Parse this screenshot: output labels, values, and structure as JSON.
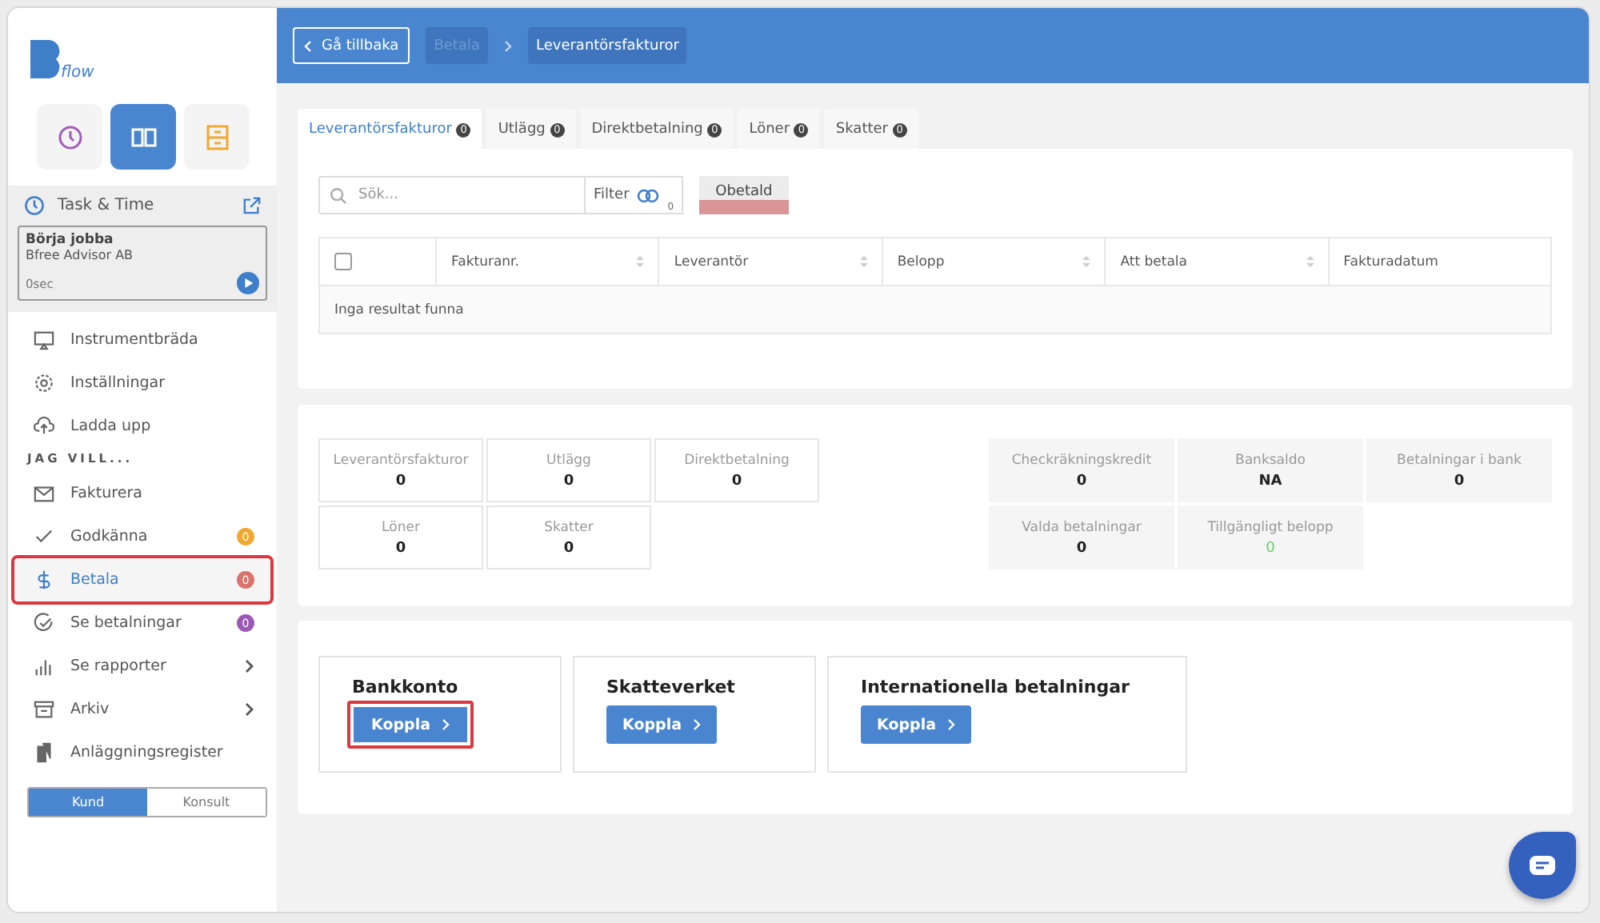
{
  "logo": {
    "text": "flow"
  },
  "app_tiles": [
    {
      "kind": "clock",
      "selected": false
    },
    {
      "kind": "book",
      "selected": true
    },
    {
      "kind": "cabinet",
      "selected": false
    }
  ],
  "task_time": {
    "title": "Task & Time",
    "card_title": "Börja jobba",
    "company": "Bfree Advisor AB",
    "elapsed": "0sec"
  },
  "nav": [
    {
      "label": "Instrumentbräda",
      "kind": "monitor",
      "selected": false
    },
    {
      "label": "Inställningar",
      "kind": "gear",
      "selected": false
    },
    {
      "label": "Ladda upp",
      "kind": "upload",
      "selected": false
    }
  ],
  "nav_section": "JAG VILL...",
  "nav2": [
    {
      "label": "Fakturera",
      "kind": "mail",
      "selected": false
    },
    {
      "label": "Godkänna",
      "kind": "check",
      "selected": false,
      "badge": "0",
      "color": "#f0a830"
    },
    {
      "label": "Betala",
      "kind": "dollar",
      "selected": true,
      "highlighted": true,
      "badge": "0",
      "color": "#d9736b"
    },
    {
      "label": "Se betalningar",
      "kind": "checkcircle",
      "selected": false,
      "badge": "0",
      "color": "#9b59b6"
    },
    {
      "label": "Se rapporter",
      "kind": "bars",
      "selected": false,
      "submenu": true
    },
    {
      "label": "Arkiv",
      "kind": "archive",
      "selected": false,
      "submenu": true
    },
    {
      "label": "Anläggningsregister",
      "kind": "files",
      "selected": false
    }
  ],
  "mode_toggle": [
    {
      "label": "Kund",
      "selected": true
    },
    {
      "label": "Konsult",
      "selected": false
    }
  ],
  "header": {
    "back": "Gå tillbaka",
    "breadcrumbs": [
      {
        "label": "Betala",
        "selected": false
      },
      {
        "label": "Leverantörsfakturor",
        "selected": true
      }
    ]
  },
  "tabs": [
    {
      "label": "Leverantörsfakturor",
      "count": "0",
      "selected": true
    },
    {
      "label": "Utlägg",
      "count": "0",
      "selected": false
    },
    {
      "label": "Direktbetalning",
      "count": "0",
      "selected": false
    },
    {
      "label": "Löner",
      "count": "0",
      "selected": false
    },
    {
      "label": "Skatter",
      "count": "0",
      "selected": false
    }
  ],
  "search": {
    "placeholder": "Sök...",
    "filter": "Filter",
    "filter_count": "0",
    "status_chip": "Obetald"
  },
  "table": {
    "select_all_checked": false,
    "columns": [
      {
        "label": "Fakturanr.",
        "sortable": true
      },
      {
        "label": "Leverantör",
        "sortable": true
      },
      {
        "label": "Belopp",
        "sortable": true
      },
      {
        "label": "Att betala",
        "sortable": true
      },
      {
        "label": "Fakturadatum",
        "sortable": false
      }
    ],
    "empty": "Inga resultat funna"
  },
  "counts": [
    {
      "label": "Leverantörsfakturor",
      "value": "0"
    },
    {
      "label": "Utlägg",
      "value": "0"
    },
    {
      "label": "Direktbetalning",
      "value": "0"
    },
    {
      "label": "Löner",
      "value": "0"
    },
    {
      "label": "Skatter",
      "value": "0"
    }
  ],
  "balances": [
    {
      "label": "Checkräkningskredit",
      "value": "0",
      "positive": false
    },
    {
      "label": "Banksaldo",
      "value": "NA",
      "positive": false
    },
    {
      "label": "Betalningar i bank",
      "value": "0",
      "positive": false
    },
    {
      "label": "Valda betalningar",
      "value": "0",
      "positive": false
    },
    {
      "label": "Tillgängligt belopp",
      "value": "0",
      "positive": true
    }
  ],
  "connections": [
    {
      "title": "Bankkonto",
      "button": "Koppla",
      "highlighted": true
    },
    {
      "title": "Skatteverket",
      "button": "Koppla",
      "highlighted": false
    },
    {
      "title": "Internationella betalningar",
      "button": "Koppla",
      "highlighted": false
    }
  ]
}
